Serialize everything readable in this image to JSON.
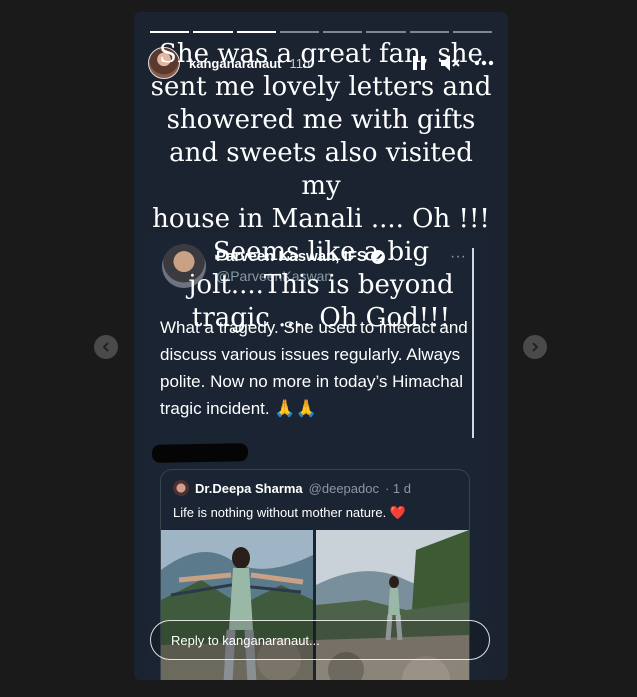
{
  "story": {
    "username": "kanganaranaut",
    "time": "11h",
    "progress_segments": 8,
    "progress_done": 3,
    "caption_lines": [
      "She was a great fan, she",
      "sent me lovely letters and",
      "showered me with gifts",
      "and sweets also visited my",
      "house in Manali .... Oh !!!",
      "Seems like a big",
      "jolt....This is beyond",
      "tragic .... Oh God!!!"
    ],
    "icons": {
      "pause": "pause-icon",
      "mute": "mute-icon",
      "more": "more-icon"
    }
  },
  "tweet": {
    "name": "Parveen Kaswan, IFS",
    "handle": "@ParveenKaswan",
    "more": "···",
    "text": "What a tragedy. She used to interact and discuss various issues regularly. Always polite. Now no more in today’s Himachal tragic incident. 🙏🙏"
  },
  "quote": {
    "name": "Dr.Deepa Sharma",
    "handle": "@deepadoc",
    "time": "· 1 d",
    "text": "Life is nothing without mother nature. ❤️"
  },
  "reply": {
    "placeholder": "Reply to kanganaranaut..."
  },
  "colors": {
    "story_bg": "#1b2230",
    "tweet_bg": "#1a2432",
    "muted": "#8899a6"
  }
}
